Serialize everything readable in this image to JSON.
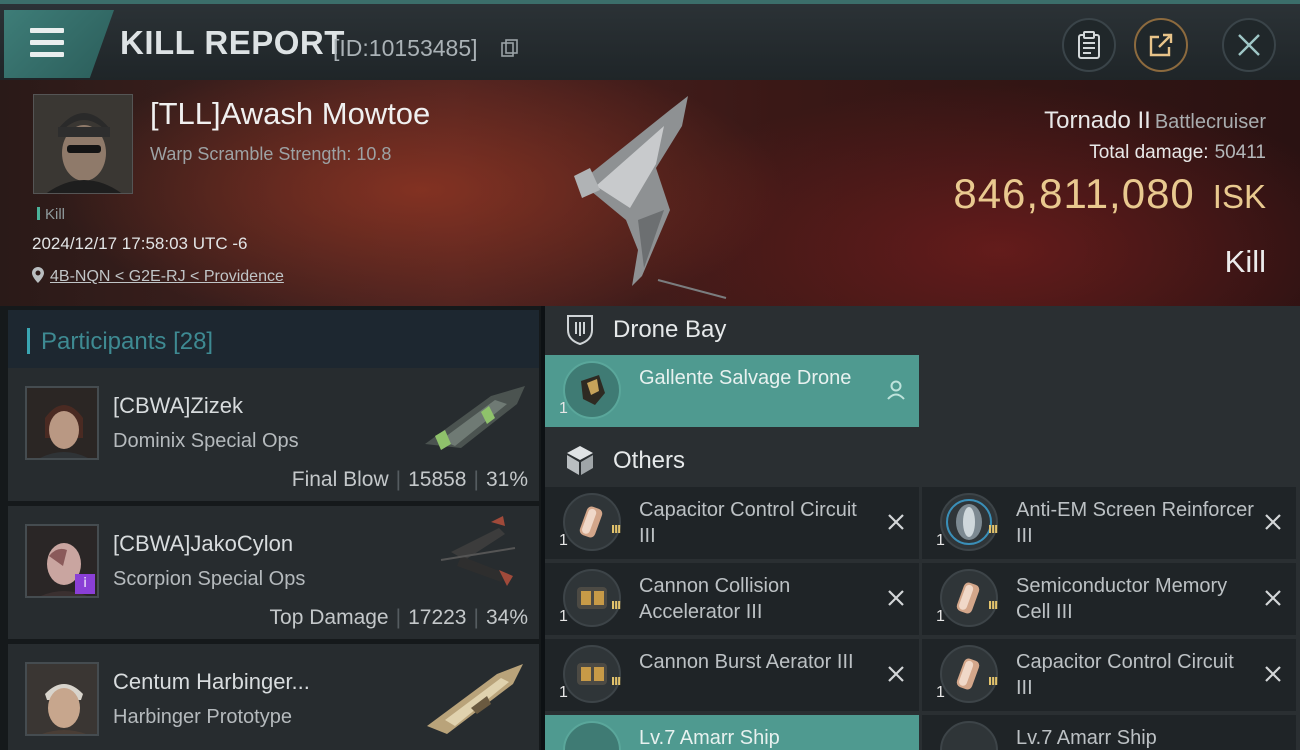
{
  "header": {
    "title": "KILL REPORT",
    "report_id": "[ID:10153485]",
    "menu_icon": "hamburger-menu-icon",
    "actions": [
      {
        "name": "clipboard-icon"
      },
      {
        "name": "share-export-icon"
      },
      {
        "name": "close-icon"
      }
    ]
  },
  "victim": {
    "name": "[TLL]Awash Mowtoe",
    "subtitle": "Warp Scramble Strength: 10.8",
    "tag": "Kill",
    "datetime": "2024/12/17 17:58:03 UTC -6",
    "location": "4B-NQN < G2E-RJ < Providence",
    "ship_name": "Tornado II",
    "ship_class": "Battlecruiser",
    "damage_label": "Total damage:",
    "damage_value": "50411",
    "isk_value": "846,811,080",
    "isk_unit": "ISK",
    "result": "Kill"
  },
  "participants": {
    "title": "Participants",
    "count": "[28]",
    "list": [
      {
        "name": "[CBWA]Zizek",
        "ship": "Dominix Special Ops",
        "role": "Final Blow",
        "damage": "15858",
        "percent": "31%"
      },
      {
        "name": "[CBWA]JakoCylon",
        "ship": "Scorpion Special Ops",
        "role": "Top Damage",
        "damage": "17223",
        "percent": "34%"
      },
      {
        "name": "Centum Harbinger...",
        "ship": "Harbinger Prototype",
        "role": "",
        "damage": "",
        "percent": ""
      }
    ]
  },
  "drone_bay": {
    "title": "Drone Bay",
    "items": [
      {
        "name": "Gallente Salvage Drone",
        "qty": "1",
        "status": "person-icon"
      }
    ]
  },
  "others": {
    "title": "Others",
    "items": [
      {
        "name": "Capacitor Control Circuit III",
        "qty": "1",
        "meta": "III",
        "status": "destroyed-x-icon"
      },
      {
        "name": "Anti-EM Screen Reinforcer III",
        "qty": "1",
        "meta": "III",
        "status": "destroyed-x-icon"
      },
      {
        "name": "Cannon Collision Accelerator III",
        "qty": "1",
        "meta": "III",
        "status": "destroyed-x-icon"
      },
      {
        "name": "Semiconductor Memory Cell III",
        "qty": "1",
        "meta": "III",
        "status": "destroyed-x-icon"
      },
      {
        "name": "Cannon Burst Aerator III",
        "qty": "1",
        "meta": "III",
        "status": "destroyed-x-icon"
      },
      {
        "name": "Capacitor Control Circuit III",
        "qty": "1",
        "meta": "III",
        "status": "destroyed-x-icon"
      },
      {
        "name": "Lv.7 Amarr Ship",
        "qty": "",
        "meta": "",
        "status": ""
      },
      {
        "name": "Lv.7 Amarr Ship",
        "qty": "",
        "meta": "",
        "status": ""
      }
    ]
  },
  "colors": {
    "accent_teal": "#4f9a90",
    "isk_gold": "#e9c98f",
    "participants_title": "#3e8a92"
  }
}
